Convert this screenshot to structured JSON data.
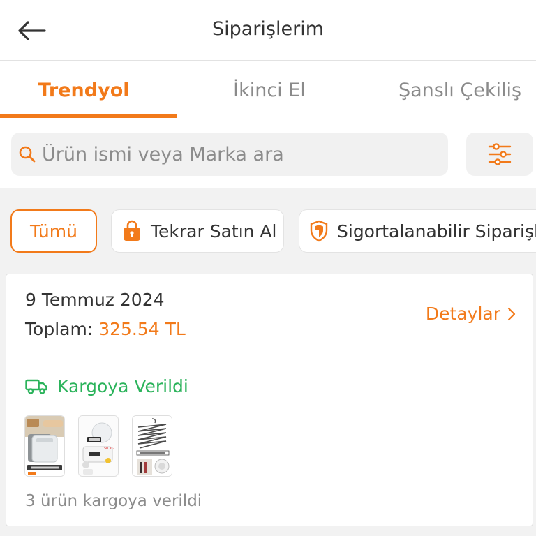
{
  "header": {
    "title": "Siparişlerim",
    "back_icon": "arrow-left-icon"
  },
  "tabs": [
    {
      "label": "Trendyol",
      "active": true
    },
    {
      "label": "İkinci El",
      "active": false
    },
    {
      "label": "Şanslı Çekiliş",
      "active": false
    }
  ],
  "search": {
    "placeholder": "Ürün ismi veya Marka ara",
    "value": "",
    "icon": "search-icon",
    "filter_icon": "sliders-icon"
  },
  "chips": [
    {
      "label": "Tümü",
      "active": true
    },
    {
      "label": "Tekrar Satın Al",
      "icon": "shopping-bag-lock-icon",
      "active": false
    },
    {
      "label": "Sigortalanabilir Siparişler",
      "icon": "shield-icon",
      "active": false
    }
  ],
  "order": {
    "date": "9 Temmuz 2024",
    "total_label": "Toplam:",
    "total_amount": "325.54 TL",
    "details_label": "Detaylar",
    "status": "Kargoya Verildi",
    "status_icon": "truck-icon",
    "products": [
      {
        "name": "product-thumbnail-bin"
      },
      {
        "name": "product-thumbnail-scale"
      },
      {
        "name": "product-thumbnail-hanger"
      }
    ],
    "shipment_note": "3 ürün kargoya verildi"
  },
  "colors": {
    "accent": "#f27a1a",
    "success": "#2bb35b",
    "text": "#333333",
    "muted": "#8c8c8c"
  }
}
